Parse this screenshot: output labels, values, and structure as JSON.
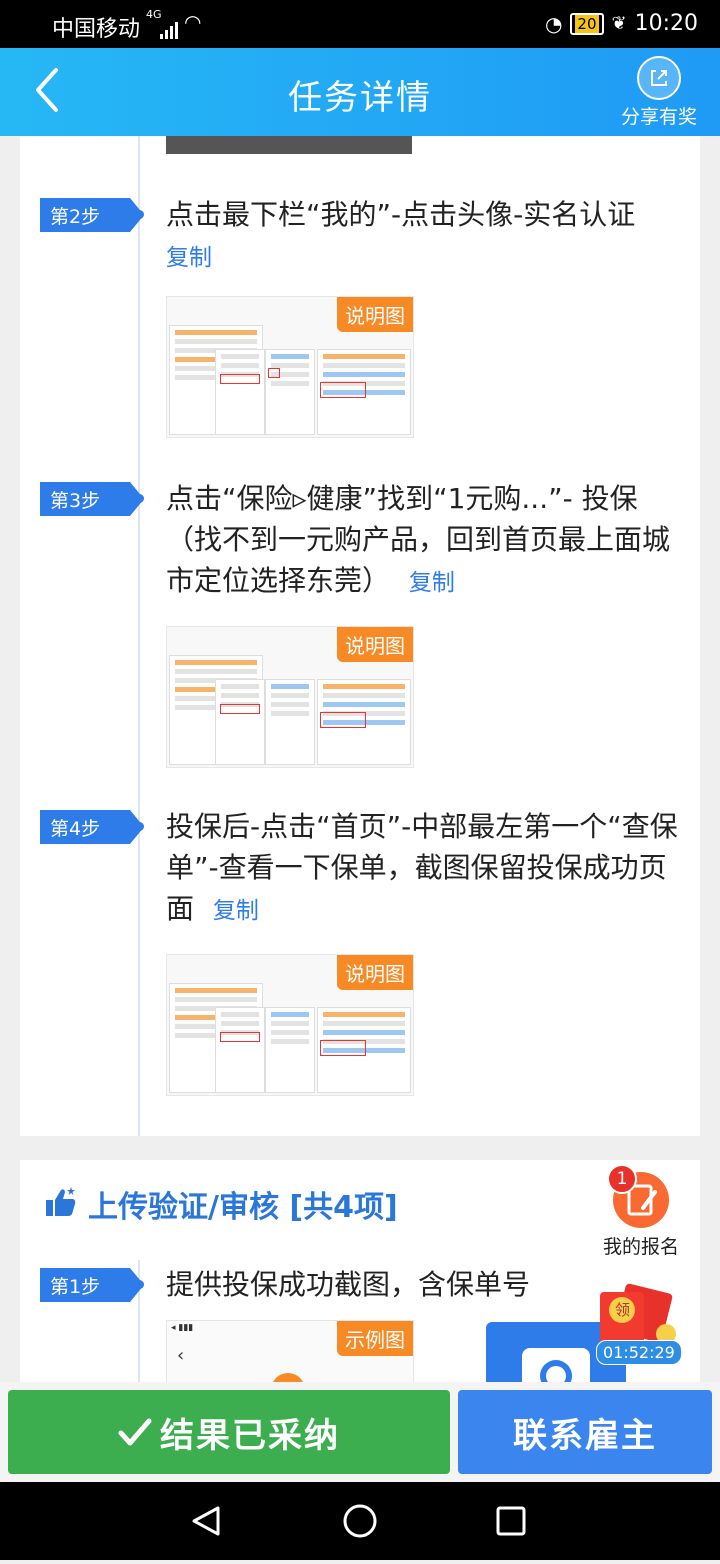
{
  "status_bar": {
    "carrier": "中国移动",
    "network": "4G",
    "battery": "20",
    "time": "10:20"
  },
  "header": {
    "title": "任务详情",
    "share_label": "分享有奖"
  },
  "steps": [
    {
      "tag": "第2步",
      "text": "点击最下栏“我的”-点击头像-实名认证",
      "copy": "复制",
      "image_badge": "说明图"
    },
    {
      "tag": "第3步",
      "text": "点击“保险▹健康”找到“1元购...”- 投保（找不到一元购产品，回到首页最上面城市定位选择东莞）",
      "copy": "复制",
      "image_badge": "说明图"
    },
    {
      "tag": "第4步",
      "text": "投保后-点击“首页”-中部最左第一个“查保单”-查看一下保单，截图保留投保成功页面",
      "copy": "复制",
      "image_badge": "说明图"
    }
  ],
  "upload": {
    "title": "上传验证/审核 [共4项]",
    "steps": [
      {
        "tag": "第1步",
        "text": "提供投保成功截图，含保单号",
        "image_badge": "示例图"
      }
    ]
  },
  "floating": {
    "signup_count": "1",
    "signup_label": "我的报名",
    "redpack_label": "领",
    "timer": "01:52:29"
  },
  "bottom": {
    "accepted_label": "结果已采纳",
    "contact_label": "联系雇主"
  },
  "colors": {
    "header": "#1f9af5",
    "accent": "#2e7bea",
    "badge": "#f88a25",
    "green": "#3cae50"
  }
}
